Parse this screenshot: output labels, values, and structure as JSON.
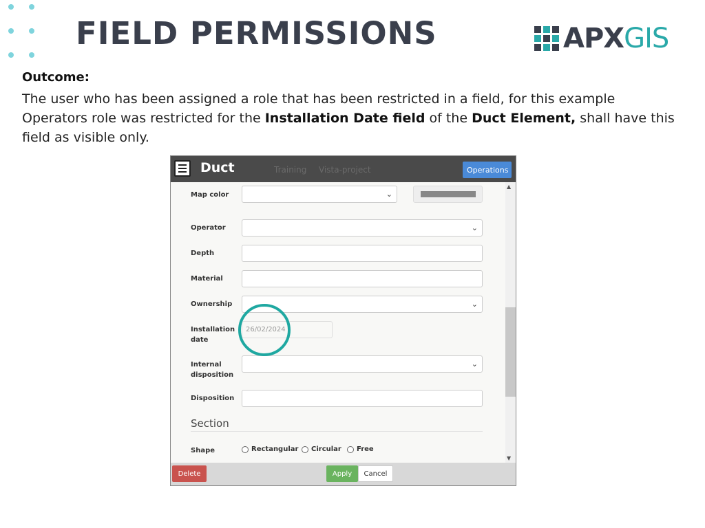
{
  "slide": {
    "title": "FIELD PERMISSIONS",
    "logo_primary": "APX",
    "logo_secondary": "GIS",
    "outcome_label": "Outcome:",
    "desc_part1": "The user who has been assigned a role that has been restricted in a field, for this example Operators role was restricted for the ",
    "desc_bold1": "Installation Date field",
    "desc_part2": " of the ",
    "desc_bold2": "Duct Element,",
    "desc_part3": " shall have this field as visible only."
  },
  "dialog": {
    "title": "Duct",
    "background_text_1": "Training",
    "background_text_2": "Vista-project",
    "operations_label": "Operations",
    "fields": {
      "map_color": "Map color",
      "operator": "Operator",
      "depth": "Depth",
      "material": "Material",
      "ownership": "Ownership",
      "installation_date_line1": "Installation",
      "installation_date_line2": "date",
      "installation_date_value": "26/02/2024",
      "internal_disposition_line1": "Internal",
      "internal_disposition_line2": "disposition",
      "disposition": "Disposition"
    },
    "section_title": "Section",
    "shape_label": "Shape",
    "shape_options": [
      "Rectangular",
      "Circular",
      "Free"
    ],
    "buttons": {
      "delete": "Delete",
      "apply": "Apply",
      "cancel": "Cancel"
    }
  },
  "colors": {
    "accent_teal": "#1fa8a1",
    "title_dark": "#3a3f4c",
    "operations_blue": "#4a8ad8",
    "delete_red": "#c9534e",
    "apply_green": "#6ab35f"
  },
  "icons": [
    "list-icon",
    "chevron-down-icon",
    "scroll-up-icon",
    "scroll-down-icon",
    "radio-icon"
  ]
}
